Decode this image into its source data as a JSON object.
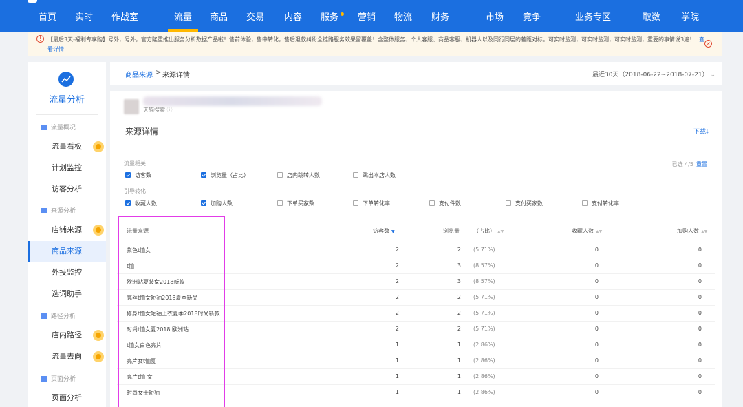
{
  "nav": {
    "items": [
      "首页",
      "实时",
      "作战室",
      "流量",
      "商品",
      "交易",
      "内容",
      "服务",
      "营销",
      "物流",
      "财务",
      "市场",
      "竞争",
      "业务专区",
      "取数",
      "学院"
    ],
    "active_index": 3
  },
  "notice": {
    "text": "【最后3天-福利专享购】号外，号外，官方隆重推出服务分析数据产品啦！售前体验，售中转化，售后退款纠纷全链路服务效果留覆盖！含整体服务、个人客服、商品客服、机器人以及同行同层的差距对标。可实时监测，可实时监测，可实时监测，重要的事情说3遍！",
    "link": "查看详情"
  },
  "sidebar": {
    "title": "流量分析",
    "groups": [
      {
        "label": "流量概况",
        "items": [
          "流量看板",
          "计划监控",
          "访客分析"
        ]
      },
      {
        "label": "来源分析",
        "items": [
          "店铺来源",
          "商品来源",
          "外投监控",
          "选词助手"
        ]
      },
      {
        "label": "路径分析",
        "items": [
          "店内路径",
          "流量去向"
        ]
      },
      {
        "label": "页面分析",
        "items": [
          "页面分析"
        ]
      }
    ]
  },
  "breadcrumb": {
    "parent": "商品来源",
    "separator": ">",
    "current": "来源详情"
  },
  "date_range": "最近30天（2018-06-22~2018-07-21）",
  "product": {
    "sub_label": "天猫搜索"
  },
  "section": {
    "title": "来源详情",
    "download": "下载"
  },
  "filters": {
    "group1_label": "流量相关",
    "group1": [
      {
        "label": "访客数",
        "checked": true
      },
      {
        "label": "浏览量（占比）",
        "checked": true
      },
      {
        "label": "店内跳转人数",
        "checked": false
      },
      {
        "label": "跳出本店人数",
        "checked": false
      }
    ],
    "group2_label": "引导转化",
    "group2": [
      {
        "label": "收藏人数",
        "checked": true
      },
      {
        "label": "加购人数",
        "checked": true
      },
      {
        "label": "下单买家数",
        "checked": false
      },
      {
        "label": "下单转化率",
        "checked": false
      },
      {
        "label": "支付件数",
        "checked": false
      },
      {
        "label": "支付买家数",
        "checked": false
      },
      {
        "label": "支付转化率",
        "checked": false
      }
    ],
    "selected_text": "已选 4/5",
    "reset": "重置"
  },
  "table": {
    "headers": {
      "source": "流量来源",
      "visitors": "访客数",
      "pv": "浏览量",
      "pct": "（占比）",
      "fav": "收藏人数",
      "cart": "加购人数"
    },
    "rows": [
      {
        "source": "紫色t恤女",
        "visitors": "2",
        "pv": "2",
        "pct": "(5.71%)",
        "fav": "0",
        "cart": "0"
      },
      {
        "source": "t恤",
        "visitors": "2",
        "pv": "3",
        "pct": "(8.57%)",
        "fav": "0",
        "cart": "0"
      },
      {
        "source": "欧洲站夏装女2018新款",
        "visitors": "2",
        "pv": "3",
        "pct": "(8.57%)",
        "fav": "0",
        "cart": "0"
      },
      {
        "source": "亮丝t恤女短袖2018夏季新品",
        "visitors": "2",
        "pv": "2",
        "pct": "(5.71%)",
        "fav": "0",
        "cart": "0"
      },
      {
        "source": "修身t恤女短袖上衣夏季2018时尚新款",
        "visitors": "2",
        "pv": "2",
        "pct": "(5.71%)",
        "fav": "0",
        "cart": "0"
      },
      {
        "source": "时尚t恤女夏2018 欧洲站",
        "visitors": "2",
        "pv": "2",
        "pct": "(5.71%)",
        "fav": "0",
        "cart": "0"
      },
      {
        "source": "t恤女白色亮片",
        "visitors": "1",
        "pv": "1",
        "pct": "(2.86%)",
        "fav": "0",
        "cart": "0"
      },
      {
        "source": "亮片女t恤夏",
        "visitors": "1",
        "pv": "1",
        "pct": "(2.86%)",
        "fav": "0",
        "cart": "0"
      },
      {
        "source": "亮片t恤 女",
        "visitors": "1",
        "pv": "1",
        "pct": "(2.86%)",
        "fav": "0",
        "cart": "0"
      },
      {
        "source": "时尚女士短袖",
        "visitors": "1",
        "pv": "1",
        "pct": "(2.86%)",
        "fav": "0",
        "cart": "0"
      }
    ]
  },
  "colors": {
    "brand": "#1b6fe0",
    "accent": "#ffb800",
    "highlight": "#e23ce8"
  }
}
